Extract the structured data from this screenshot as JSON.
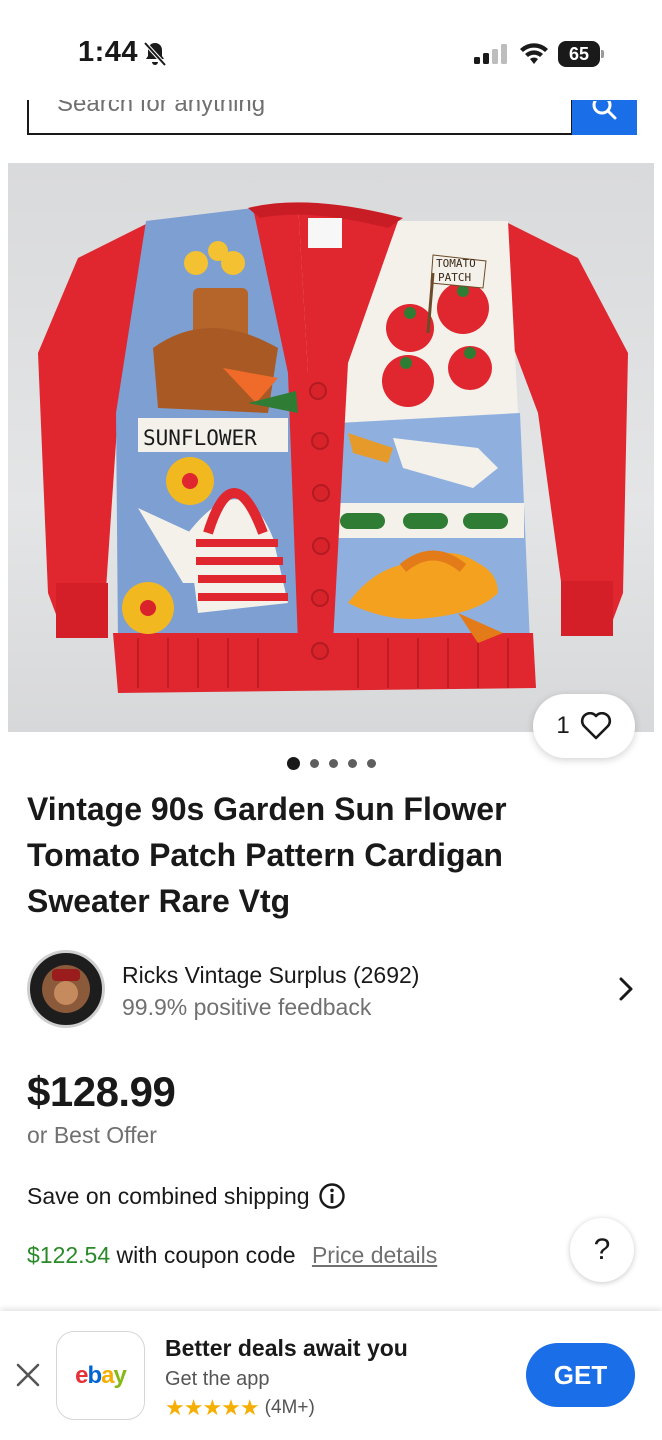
{
  "status_bar": {
    "time": "1:44",
    "battery": "65"
  },
  "search": {
    "placeholder": "Search for anything"
  },
  "listing": {
    "favorites_count": "1",
    "gallery": {
      "total_images": 5,
      "current_index": 1
    },
    "title": "Vintage 90s Garden Sun Flower Tomato Patch Pattern Cardigan Sweater Rare Vtg",
    "seller": {
      "name": "Ricks Vintage Surplus (2692)",
      "feedback": "99.9% positive feedback"
    },
    "price": "$128.99",
    "best_offer": "or Best Offer",
    "combined_shipping": "Save on combined shipping",
    "coupon_price": "$122.54",
    "coupon_text": "with coupon code",
    "price_details_link": "Price details",
    "help_label": "?"
  },
  "sweater_image": {
    "sunflower_text": "SUNFLOWER",
    "tomato_text_1": "TOMATO",
    "tomato_text_2": "PATCH"
  },
  "app_banner": {
    "title": "Better deals await you",
    "subtitle": "Get the app",
    "stars": "★★★★★",
    "ratings_count": "(4M+)",
    "cta": "GET",
    "logo_letters": [
      "e",
      "b",
      "a",
      "y"
    ]
  },
  "colors": {
    "accent_blue": "#1a6ee8",
    "coupon_green": "#2a8a2a",
    "sweater_red": "#e0262e"
  }
}
